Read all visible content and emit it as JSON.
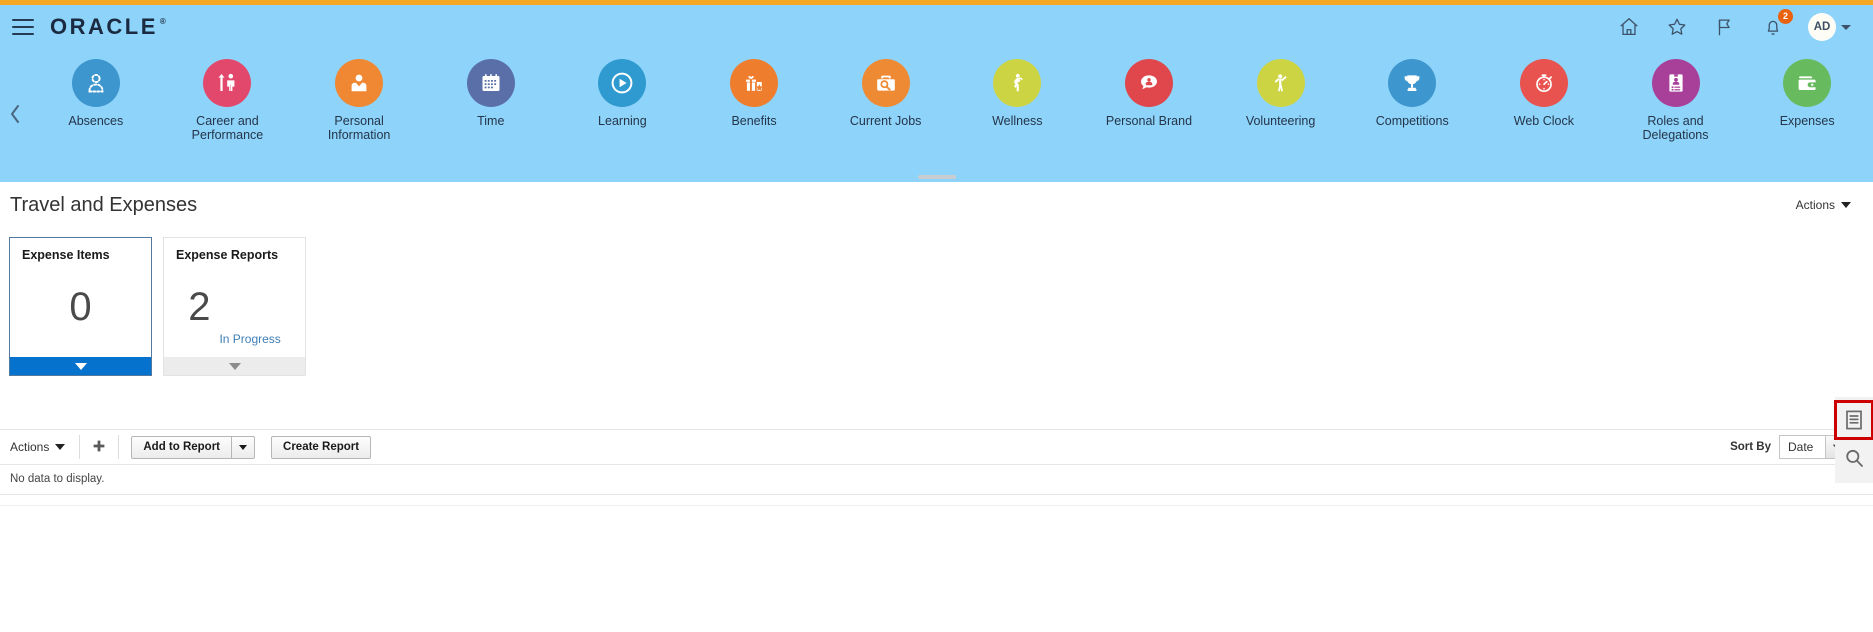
{
  "theme": {
    "accent_orange": "#f5a623",
    "header_blue": "#8ed3f9",
    "selected_blue": "#0572ce",
    "link_blue": "#3f7fb5",
    "highlight_red": "#cc0000"
  },
  "header": {
    "brand": "ORACLE",
    "menu_icon": "hamburger-icon",
    "icons": [
      {
        "name": "home-icon",
        "label": "Home"
      },
      {
        "name": "star-icon",
        "label": "Favorites and Recent Items"
      },
      {
        "name": "flag-icon",
        "label": "Watchlist"
      },
      {
        "name": "bell-icon",
        "label": "Notifications",
        "badge": "2"
      }
    ],
    "user": {
      "initials": "AD",
      "name": "avatar"
    }
  },
  "springboard": {
    "back_arrow": "chevron-left-icon",
    "items": [
      {
        "label": "Absences",
        "icon": "person-dotted-icon",
        "color": "#3d96cd"
      },
      {
        "label": "Career and Performance",
        "icon": "people-arrow-icon",
        "color": "#e2486c"
      },
      {
        "label": "Personal Information",
        "icon": "person-card-icon",
        "color": "#ef8733"
      },
      {
        "label": "Time",
        "icon": "calendar-icon",
        "color": "#5a6fa8"
      },
      {
        "label": "Learning",
        "icon": "play-circle-icon",
        "color": "#2e9ad0"
      },
      {
        "label": "Benefits",
        "icon": "gift-icon",
        "color": "#ef7d2e"
      },
      {
        "label": "Current Jobs",
        "icon": "briefcase-search-icon",
        "color": "#ef8a34"
      },
      {
        "label": "Wellness",
        "icon": "runner-icon",
        "color": "#cdd444"
      },
      {
        "label": "Personal Brand",
        "icon": "speech-person-icon",
        "color": "#e0474c"
      },
      {
        "label": "Volunteering",
        "icon": "volunteer-icon",
        "color": "#cdd444"
      },
      {
        "label": "Competitions",
        "icon": "trophy-icon",
        "color": "#3d96cd"
      },
      {
        "label": "Web Clock",
        "icon": "stopwatch-icon",
        "color": "#e8524f"
      },
      {
        "label": "Roles and Delegations",
        "icon": "id-badge-icon",
        "color": "#a84099"
      },
      {
        "label": "Expenses",
        "icon": "wallet-icon",
        "color": "#67bb5e"
      }
    ],
    "drag_handle": "resize-handle"
  },
  "page": {
    "title": "Travel and Expenses",
    "actions_label": "Actions"
  },
  "infolets": [
    {
      "title": "Expense Items",
      "value": "0",
      "sub_label": "",
      "selected": true,
      "footer_icon": "chevron-down-icon"
    },
    {
      "title": "Expense Reports",
      "value": "2",
      "sub_label": "In Progress",
      "selected": false,
      "footer_icon": "chevron-down-icon"
    }
  ],
  "toolbar": {
    "actions_label": "Actions",
    "add_icon": "plus-icon",
    "add_to_report_label": "Add to Report",
    "add_to_report_dropdown_icon": "chevron-down-icon",
    "create_report_label": "Create Report",
    "sort_by_label": "Sort By",
    "sort_by_value": "Date",
    "sort_by_options": [
      "Date"
    ],
    "sort_dropdown_icon": "chevron-down-icon"
  },
  "list": {
    "empty_message": "No data to display."
  },
  "right_rail": {
    "buttons": [
      {
        "name": "list-panel-icon",
        "label": "Expense Items List",
        "highlighted": true
      },
      {
        "name": "search-icon",
        "label": "Search",
        "highlighted": false
      }
    ]
  }
}
